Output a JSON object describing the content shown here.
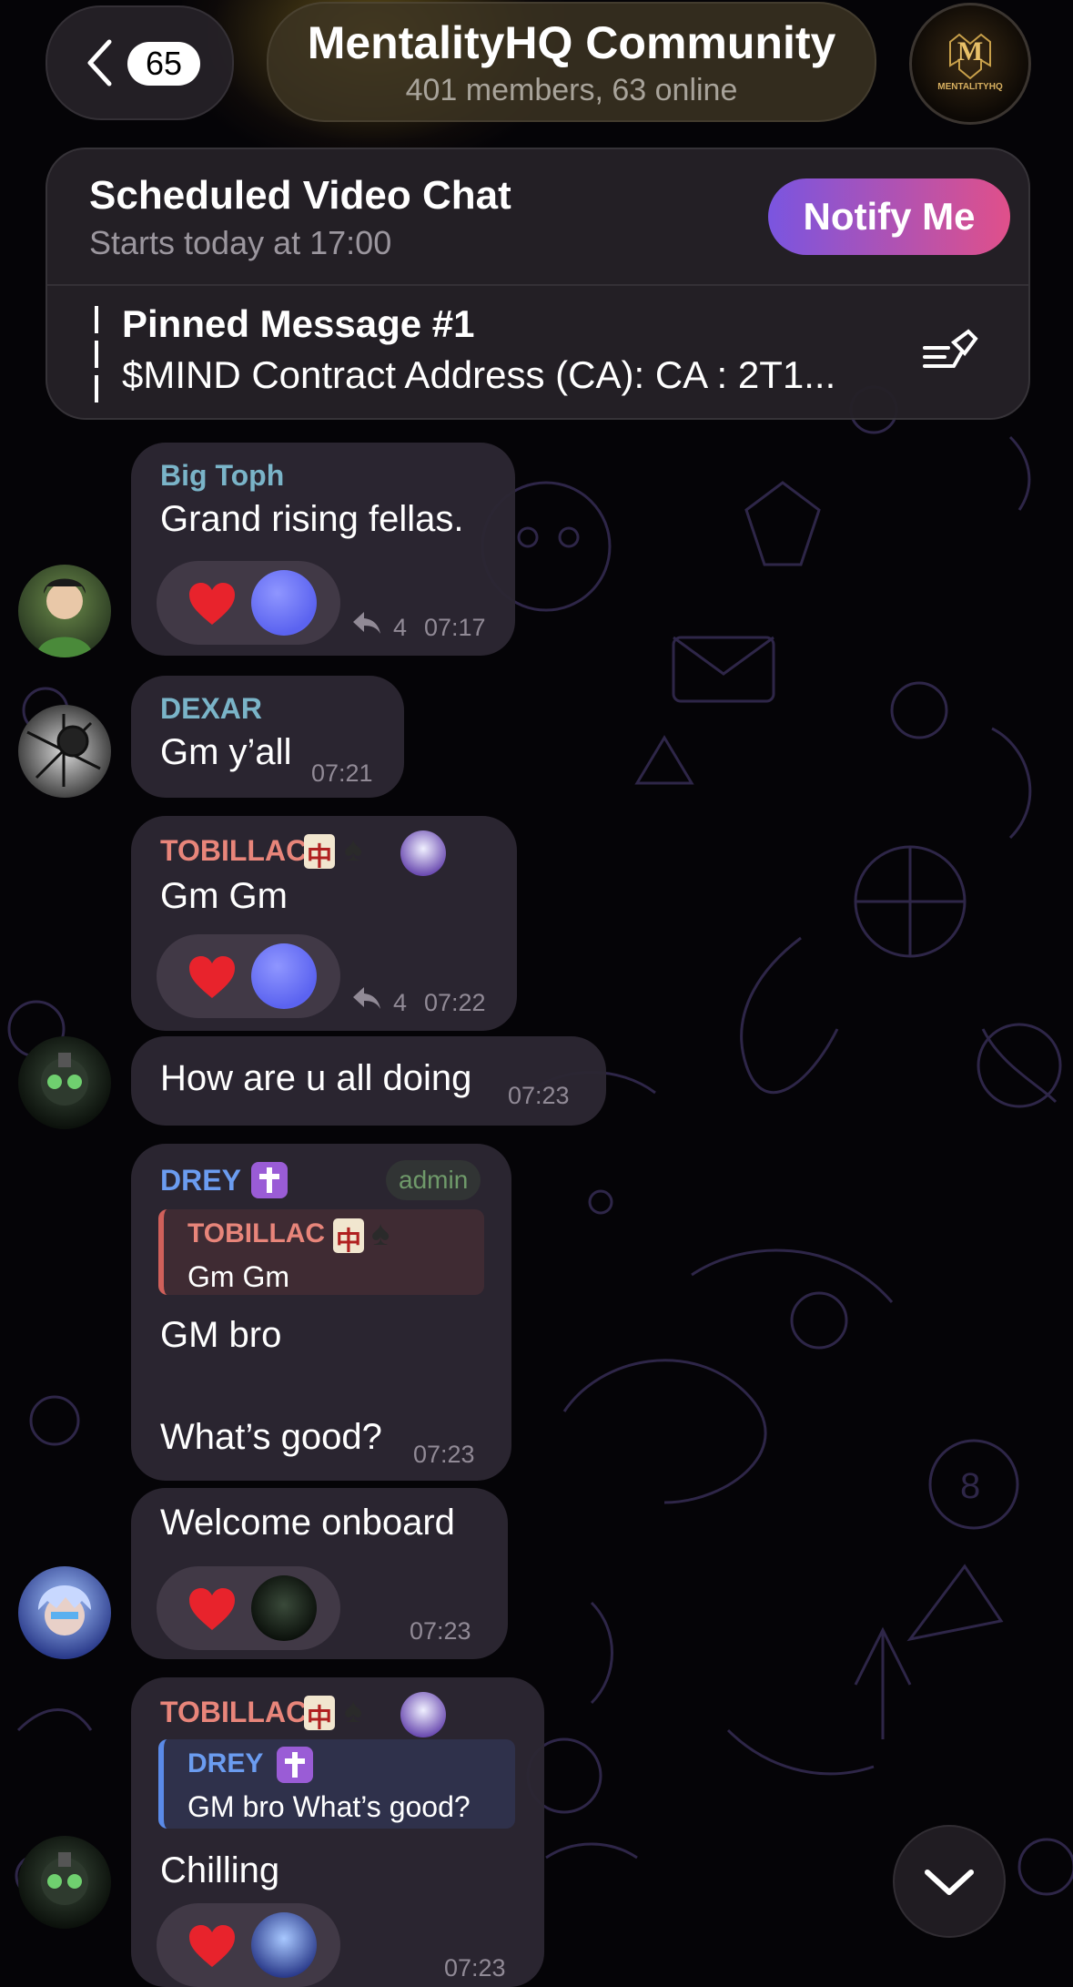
{
  "header": {
    "unread_count": "65",
    "title": "MentalityHQ Community",
    "subtitle": "401 members, 63 online",
    "group_avatar_text": "MENTALITYHQ"
  },
  "video_chat": {
    "title": "Scheduled Video Chat",
    "subtitle": "Starts today at 17:00",
    "notify_label": "Notify Me"
  },
  "pinned": {
    "title": "Pinned Message #1",
    "text": "$MIND Contract Address (CA): CA : 2T1..."
  },
  "colors": {
    "big_toph": "#7ab4c8",
    "dexar": "#7ab4c8",
    "tobillac": "#e8857a",
    "drey": "#6b9cf0",
    "admin": "#6f9a6a"
  },
  "messages": [
    {
      "sender": "Big Toph",
      "text": "Grand rising fellas.",
      "time": "07:17",
      "reply_count": "4",
      "reactions": [
        "heart",
        "blue-circle"
      ]
    },
    {
      "sender": "DEXAR",
      "text": "Gm y’all",
      "time": "07:21"
    },
    {
      "sender": "TOBILLAC",
      "text": "Gm Gm",
      "time": "07:22",
      "reply_count": "4",
      "reactions": [
        "heart",
        "blue-circle"
      ]
    },
    {
      "text": "How are u all doing",
      "time": "07:23"
    },
    {
      "sender": "DREY",
      "badge": "admin",
      "quote_sender": "TOBILLAC",
      "quote_text": "Gm Gm",
      "text_line1": "GM bro",
      "text_line2": "What’s good?",
      "time": "07:23"
    },
    {
      "text": "Welcome onboard",
      "time": "07:23",
      "reactions": [
        "heart",
        "avatar"
      ]
    },
    {
      "sender": "TOBILLAC",
      "quote_sender": "DREY",
      "quote_text": "GM bro What’s good?",
      "text": "Chilling",
      "time": "07:23",
      "reactions": [
        "heart",
        "avatar"
      ]
    }
  ]
}
